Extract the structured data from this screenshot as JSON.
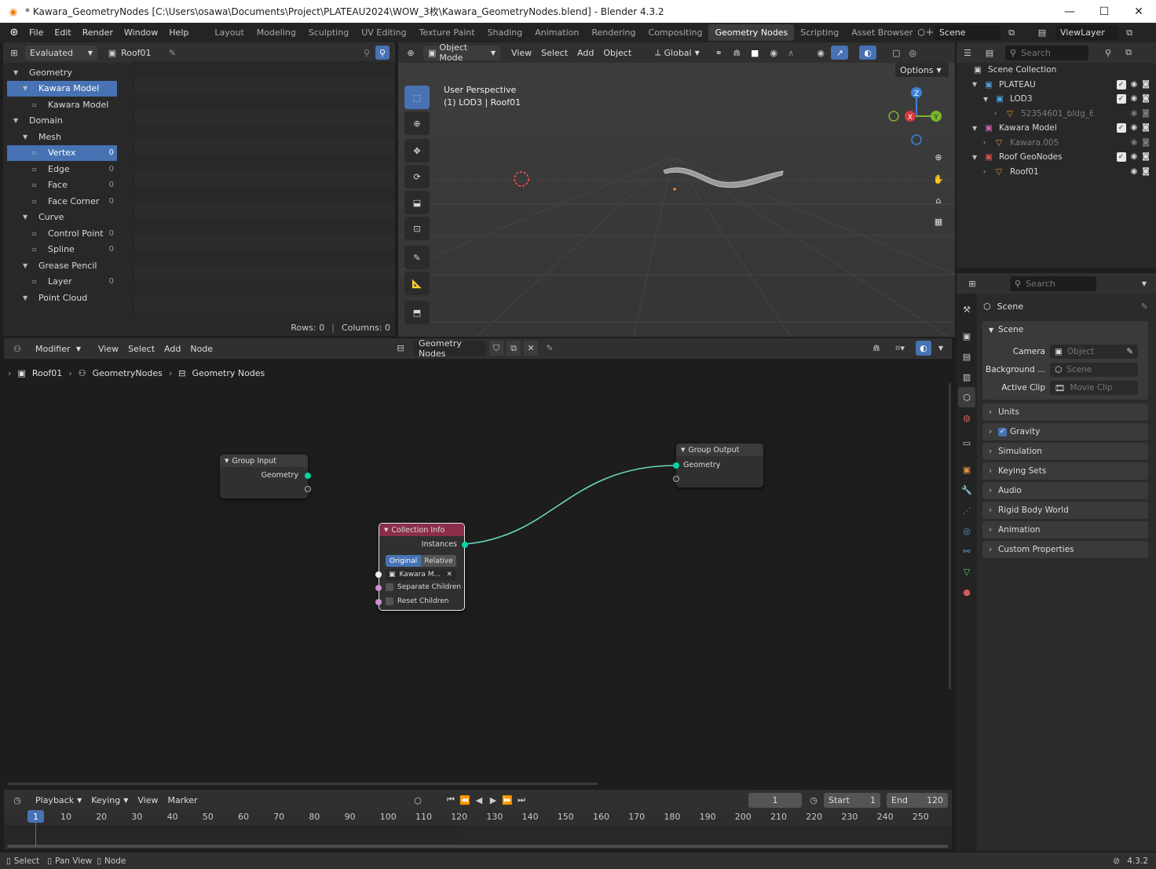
{
  "window": {
    "title": "* Kawara_GeometryNodes [C:\\Users\\osawa\\Documents\\Project\\PLATEAU2024\\WOW_3枚\\Kawara_GeometryNodes.blend] - Blender 4.3.2",
    "minimize": "—",
    "maximize": "☐",
    "close": "✕"
  },
  "menu": {
    "items": [
      "File",
      "Edit",
      "Render",
      "Window",
      "Help"
    ],
    "workspaces": [
      "Layout",
      "Modeling",
      "Sculpting",
      "UV Editing",
      "Texture Paint",
      "Shading",
      "Animation",
      "Rendering",
      "Compositing",
      "Geometry Nodes",
      "Scripting",
      "Asset Browser"
    ],
    "active_workspace": "Geometry Nodes",
    "add_tab": "+",
    "scene": "Scene",
    "view_layer": "ViewLayer"
  },
  "spreadsheet": {
    "mode": "Evaluated",
    "object": "Roof01",
    "rows_label": "Rows: 0",
    "columns_label": "Columns: 0",
    "tree": [
      {
        "label": "Geometry",
        "indent": 0,
        "kind": "header"
      },
      {
        "label": "Kawara Model",
        "indent": 1,
        "kind": "item",
        "selected": true
      },
      {
        "label": "Kawara Model",
        "indent": 2,
        "kind": "item"
      },
      {
        "label": "Domain",
        "indent": 0,
        "kind": "header"
      },
      {
        "label": "Mesh",
        "indent": 1,
        "kind": "item"
      },
      {
        "label": "Vertex",
        "indent": 2,
        "kind": "item",
        "count": "0",
        "selected": true
      },
      {
        "label": "Edge",
        "indent": 2,
        "kind": "item",
        "count": "0"
      },
      {
        "label": "Face",
        "indent": 2,
        "kind": "item",
        "count": "0"
      },
      {
        "label": "Face Corner",
        "indent": 2,
        "kind": "item",
        "count": "0"
      },
      {
        "label": "Curve",
        "indent": 1,
        "kind": "item"
      },
      {
        "label": "Control Point",
        "indent": 2,
        "kind": "item",
        "count": "0"
      },
      {
        "label": "Spline",
        "indent": 2,
        "kind": "item",
        "count": "0"
      },
      {
        "label": "Grease Pencil",
        "indent": 1,
        "kind": "item"
      },
      {
        "label": "Layer",
        "indent": 2,
        "kind": "item",
        "count": "0"
      },
      {
        "label": "Point Cloud",
        "indent": 1,
        "kind": "item"
      }
    ]
  },
  "viewport": {
    "mode": "Object Mode",
    "menus": [
      "View",
      "Select",
      "Add",
      "Object"
    ],
    "orientation": "Global",
    "options": "Options",
    "overlay_title": "User Perspective",
    "overlay_sub": "(1) LOD3 | Roof01",
    "gizmo": {
      "z": "Z",
      "y": "Y",
      "x": "X"
    }
  },
  "outliner": {
    "search_placeholder": "Search",
    "rows": [
      {
        "label": "Scene Collection",
        "indent": 0,
        "color": "#d8d8d8"
      },
      {
        "label": "PLATEAU",
        "indent": 1,
        "color": "#d8d8d8",
        "icon_color": "#4aa3df"
      },
      {
        "label": "LOD3",
        "indent": 2,
        "color": "#d8d8d8",
        "icon_color": "#4aa3df"
      },
      {
        "label": "52354601_bldg_6",
        "indent": 3,
        "color": "#7a7a7a",
        "icon_color": "#e8923a"
      },
      {
        "label": "Kawara Model",
        "indent": 1,
        "color": "#d8d8d8",
        "icon_color": "#d15fb5"
      },
      {
        "label": "Kawara.005",
        "indent": 2,
        "color": "#7a7a7a",
        "icon_color": "#e8923a"
      },
      {
        "label": "Roof GeoNodes",
        "indent": 1,
        "color": "#d8d8d8",
        "icon_color": "#e04e4e"
      },
      {
        "label": "Roof01",
        "indent": 2,
        "color": "#d8d8d8",
        "icon_color": "#e8923a"
      }
    ]
  },
  "properties": {
    "search_placeholder": "Search",
    "context": "Scene",
    "panel": "Scene",
    "camera_label": "Camera",
    "camera_value": "Object",
    "background_label": "Background ...",
    "background_value": "Scene",
    "clip_label": "Active Clip",
    "clip_value": "Movie Clip",
    "sections": [
      "Units",
      "Gravity",
      "Simulation",
      "Keying Sets",
      "Audio",
      "Rigid Body World",
      "Animation",
      "Custom Properties"
    ]
  },
  "node_editor": {
    "editor": "Modifier",
    "menus": [
      "View",
      "Select",
      "Add",
      "Node"
    ],
    "tree_name": "Geometry Nodes",
    "breadcrumb": [
      "Roof01",
      "GeometryNodes",
      "Geometry Nodes"
    ],
    "group_input": {
      "title": "Group Input",
      "socket": "Geometry"
    },
    "group_output": {
      "title": "Group Output",
      "socket": "Geometry"
    },
    "collection_info": {
      "title": "Collection Info",
      "output": "Instances",
      "toggle": [
        "Original",
        "Relative"
      ],
      "collection": "Kawara M...",
      "separate": "Separate Children",
      "reset": "Reset Children"
    }
  },
  "timeline": {
    "menus": [
      "Playback",
      "Keying",
      "View",
      "Marker"
    ],
    "current_frame": "1",
    "start_label": "Start",
    "start": "1",
    "end_label": "End",
    "end": "120",
    "ticks": [
      "10",
      "20",
      "30",
      "40",
      "50",
      "60",
      "70",
      "80",
      "90",
      "100",
      "110",
      "120",
      "130",
      "140",
      "150",
      "160",
      "170",
      "180",
      "190",
      "200",
      "210",
      "220",
      "230",
      "240",
      "250"
    ],
    "playhead": "1"
  },
  "statusbar": {
    "items": [
      "Select",
      "Pan View",
      "Node"
    ],
    "version": "4.3.2"
  }
}
